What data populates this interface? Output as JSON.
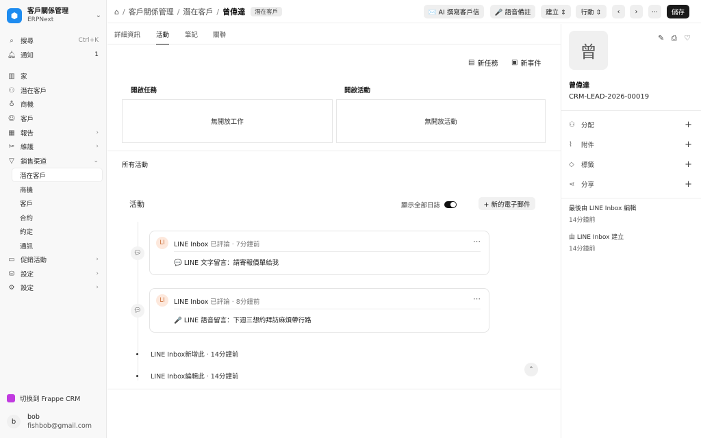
{
  "sidebar": {
    "brand_title": "客戶關係管理",
    "brand_sub": "ERPNext",
    "search": {
      "label": "搜尋",
      "shortcut": "Ctrl+K"
    },
    "notifications": {
      "label": "通知",
      "count": "1"
    },
    "items": [
      {
        "label": "家",
        "icon": "chart-icon"
      },
      {
        "label": "潛在客戶",
        "icon": "users-icon"
      },
      {
        "label": "商機",
        "icon": "bulb-icon"
      },
      {
        "label": "客戶",
        "icon": "smile-icon"
      },
      {
        "label": "報告",
        "icon": "table-icon"
      },
      {
        "label": "維護",
        "icon": "tools-icon"
      },
      {
        "label": "銷售渠道",
        "icon": "funnel-icon"
      }
    ],
    "sub_items": [
      "潛在客戶",
      "商機",
      "客戶",
      "合約",
      "約定",
      "通訊"
    ],
    "more_items": [
      {
        "label": "促銷活動",
        "icon": "campaign-icon"
      },
      {
        "label": "設定",
        "icon": "database-icon"
      },
      {
        "label": "設定",
        "icon": "gear-icon"
      }
    ],
    "switch_crm": "切換到 Frappe CRM",
    "user": {
      "initial": "b",
      "name": "bob",
      "email": "fishbob@gmail.com"
    }
  },
  "header": {
    "breadcrumb": [
      "客戶關係管理",
      "潛在客戶",
      "曾偉達"
    ],
    "status_badge": "潛在客戶",
    "ai_button": "✉️ AI 撰寫客戶信",
    "voice_button": "🎤 語音備註",
    "create_button": "建立 ⇕",
    "action_button": "行動 ⇕",
    "save_button": "儲存"
  },
  "tabs": [
    "詳細資訊",
    "活動",
    "筆記",
    "關聯"
  ],
  "active_tab": "活動",
  "main": {
    "new_task": "新任務",
    "new_event": "新事件",
    "open_tasks_title": "開啟任務",
    "open_events_title": "開啟活動",
    "no_tasks": "無開放工作",
    "no_events": "無開放活動",
    "all_activity": "所有活動",
    "activity_title": "活動",
    "show_all_logs": "顯示全部日誌",
    "new_email": "+ 新的電子郵件",
    "comments": [
      {
        "initials": "LI",
        "author": "LINE Inbox",
        "meta": "已評論 · 7分鐘前",
        "body": "💬 LINE 文字留言：請寄報價單給我"
      },
      {
        "initials": "LI",
        "author": "LINE Inbox",
        "meta": "已評論 · 8分鐘前",
        "body": "🎤 LINE 語音留言：下週三想約拜訪麻煩帶行路"
      }
    ],
    "logs": [
      "LINE Inbox新增此 · 14分鐘前",
      "LINE Inbox編輯此 · 14分鐘前"
    ]
  },
  "panel": {
    "avatar_char": "曾",
    "lead_name": "曾偉達",
    "lead_id": "CRM-LEAD-2026-00019",
    "rows": [
      "分配",
      "附件",
      "標籤",
      "分享"
    ],
    "last_edited_label": "最後由 LINE Inbox 編輯",
    "last_edited_time": "14分鐘前",
    "created_label": "由 LINE Inbox 建立",
    "created_time": "14分鐘前"
  }
}
